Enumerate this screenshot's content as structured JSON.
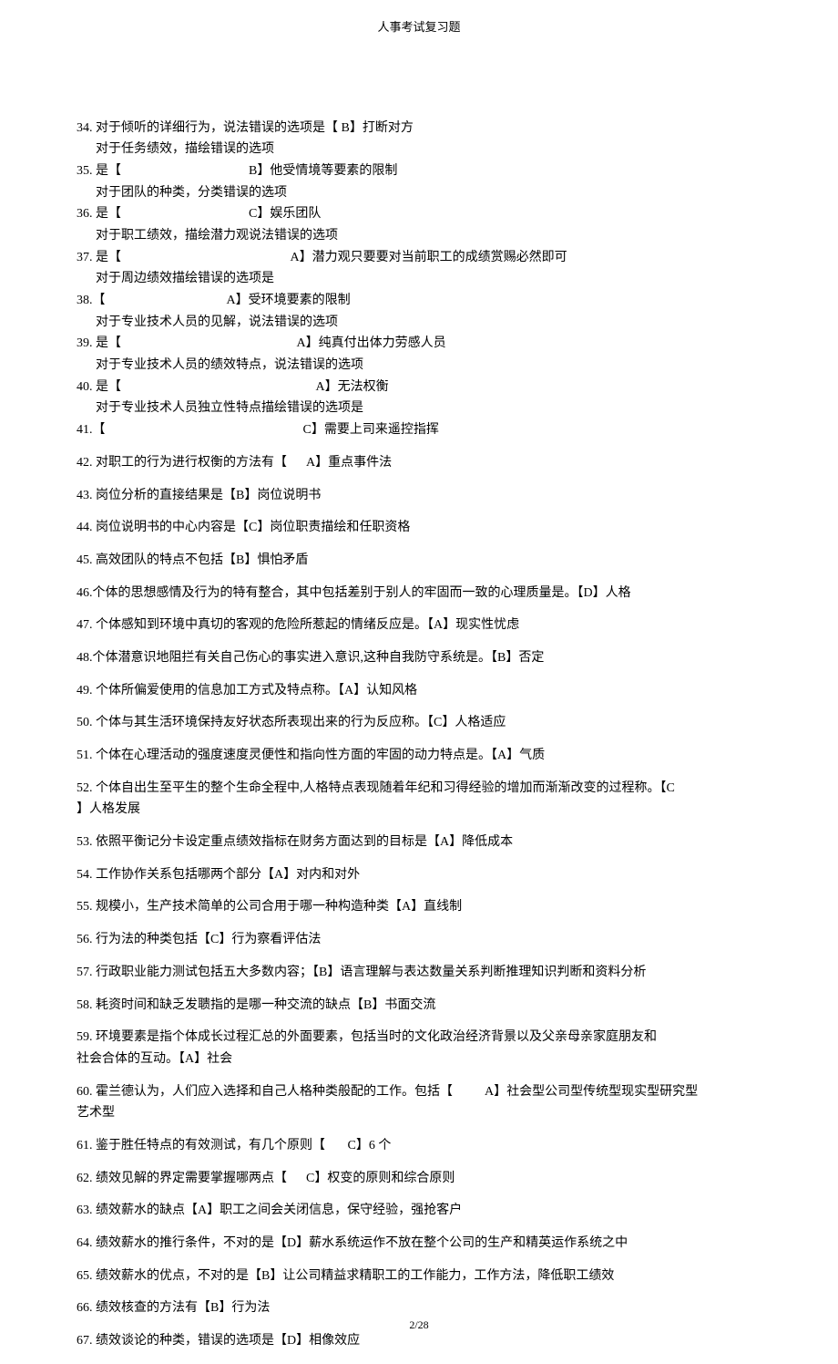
{
  "header": "人事考试复习题",
  "footer": "2/28",
  "q34_l1": "34. 对于倾听的详细行为，说法错误的选项是【 B】打断对方",
  "q34_l2": "对于任务绩效，描绘错误的选项",
  "q35_l1": "35. 是【                                        B】他受情境等要素的限制",
  "q35_l2": "对于团队的种类，分类错误的选项",
  "q36_l1": "36. 是【                                        C】娱乐团队",
  "q36_l2": "对于职工绩效，描绘潜力观说法错误的选项",
  "q37_l1": "37. 是【                                                     A】潜力观只要要对当前职工的成绩赏赐必然即可",
  "q37_l2": "对于周边绩效描绘错误的选项是",
  "q38_l1": "38.【                                      A】受环境要素的限制",
  "q38_l2": "对于专业技术人员的见解，说法错误的选项",
  "q39_l1": "39. 是【                                                       A】纯真付出体力劳感人员",
  "q39_l2": "对于专业技术人员的绩效特点，说法错误的选项",
  "q40_l1": "40. 是【                                                             A】无法权衡",
  "q40_l2": "对于专业技术人员独立性特点描绘错误的选项是",
  "q41": "41.【                                                              C】需要上司来遥控指挥",
  "q42": "42. 对职工的行为进行权衡的方法有【      A】重点事件法",
  "q43": "43. 岗位分析的直接结果是【B】岗位说明书",
  "q44": "44. 岗位说明书的中心内容是【C】岗位职责描绘和任职资格",
  "q45": "45. 高效团队的特点不包括【B】惧怕矛盾",
  "q46": "46.个体的思想感情及行为的特有整合，其中包括差别于别人的牢固而一致的心理质量是。【D】人格",
  "q47": "47. 个体感知到环境中真切的客观的危险所惹起的情绪反应是。【A】现实性忧虑",
  "q48": "48.个体潜意识地阻拦有关自己伤心的事实进入意识,这种自我防守系统是。【B】否定",
  "q49": "49. 个体所偏爱使用的信息加工方式及特点称。【A】认知风格",
  "q50": "50. 个体与其生活环境保持友好状态所表现出来的行为反应称。【C】人格适应",
  "q51": "51. 个体在心理活动的强度速度灵便性和指向性方面的牢固的动力特点是。【A】气质",
  "q52_l1": "52. 个体自出生至平生的整个生命全程中,人格特点表现随着年纪和习得经验的增加而渐渐改变的过程称。【C",
  "q52_l2": "】人格发展",
  "q53": "53. 依照平衡记分卡设定重点绩效指标在财务方面达到的目标是【A】降低成本",
  "q54": "54. 工作协作关系包括哪两个部分【A】对内和对外",
  "q55": "55. 规模小，生产技术简单的公司合用于哪一种构造种类【A】直线制",
  "q56": "56. 行为法的种类包括【C】行为察看评估法",
  "q57": "57. 行政职业能力测试包括五大多数内容；【B】语言理解与表达数量关系判断推理知识判断和资料分析",
  "q58": "58. 耗资时间和缺乏发聩指的是哪一种交流的缺点【B】书面交流",
  "q59_l1": "59. 环境要素是指个体成长过程汇总的外面要素，包括当时的文化政治经济背景以及父亲母亲家庭朋友和",
  "q59_l2": "社会合体的互动。【A】社会",
  "q60_l1": "60. 霍兰德认为，人们应入选择和自己人格种类般配的工作。包括【          A】社会型公司型传统型现实型研究型",
  "q60_l2": "艺术型",
  "q61": "61. 鉴于胜任特点的有效测试，有几个原则【       C】6 个",
  "q62": "62. 绩效见解的界定需要掌握哪两点【      C】权变的原则和综合原则",
  "q63": "63. 绩效薪水的缺点【A】职工之间会关闭信息，保守经验，强抢客户",
  "q64": "64. 绩效薪水的推行条件，不对的是【D】薪水系统运作不放在整个公司的生产和精英运作系统之中",
  "q65": "65. 绩效薪水的优点，不对的是【B】让公司精益求精职工的工作能力，工作方法，降低职工绩效",
  "q66": "66. 绩效核查的方法有【B】行为法",
  "q67": "67. 绩效谈论的种类，错误的选项是【D】相像效应"
}
